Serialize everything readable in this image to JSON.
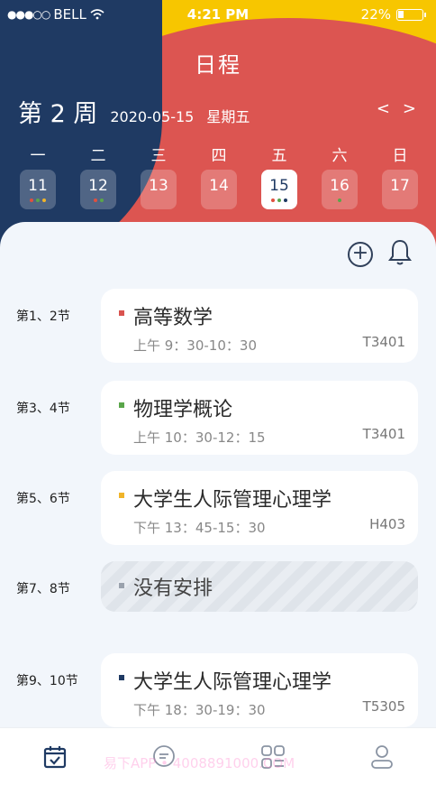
{
  "statusbar": {
    "carrier": "BELL",
    "signal_dots": "●●●○○",
    "time": "4:21 PM",
    "battery": "22%"
  },
  "header": {
    "title": "日程",
    "week": "第 2 周",
    "date": "2020-05-15",
    "weekday": "星期五",
    "prev": "<",
    "next": ">"
  },
  "days": [
    {
      "dow": "一",
      "date": "11",
      "dots": [
        "#e0503f",
        "#5aa64a",
        "#f0b429"
      ]
    },
    {
      "dow": "二",
      "date": "12",
      "dots": [
        "#e0503f",
        "#5aa64a"
      ]
    },
    {
      "dow": "三",
      "date": "13",
      "dots": []
    },
    {
      "dow": "四",
      "date": "14",
      "dots": []
    },
    {
      "dow": "五",
      "date": "15",
      "dots": [
        "#e0503f",
        "#5aa64a",
        "#1f3a63"
      ],
      "active": true
    },
    {
      "dow": "六",
      "date": "16",
      "dots": [
        "#5aa64a"
      ]
    },
    {
      "dow": "日",
      "date": "17",
      "dots": []
    }
  ],
  "schedule": [
    {
      "period": "第1、2节",
      "course": "高等数学",
      "time": "上午 9：30-10：30",
      "room": "T3401",
      "color": "#d9534f"
    },
    {
      "period": "第3、4节",
      "course": "物理学概论",
      "time": "上午 10：30-12：15",
      "room": "T3401",
      "color": "#5aa64a"
    },
    {
      "period": "第5、6节",
      "course": "大学生人际管理心理学",
      "time": "下午 13：45-15：30",
      "room": "H403",
      "color": "#f0b429"
    },
    {
      "period": "第7、8节",
      "course": "没有安排",
      "time": "",
      "room": "",
      "color": "#9aa2ad",
      "empty": true
    },
    {
      "period": "第9、10节",
      "course": "大学生人际管理心理学",
      "time": "下午 18：30-19：30",
      "room": "T5305",
      "color": "#1f3a63"
    }
  ],
  "actions": {
    "add": "+"
  },
  "tabs": [
    "calendar-icon",
    "chat-icon",
    "apps-icon",
    "profile-icon"
  ],
  "watermark": "易下APP • 4008891000.COM"
}
